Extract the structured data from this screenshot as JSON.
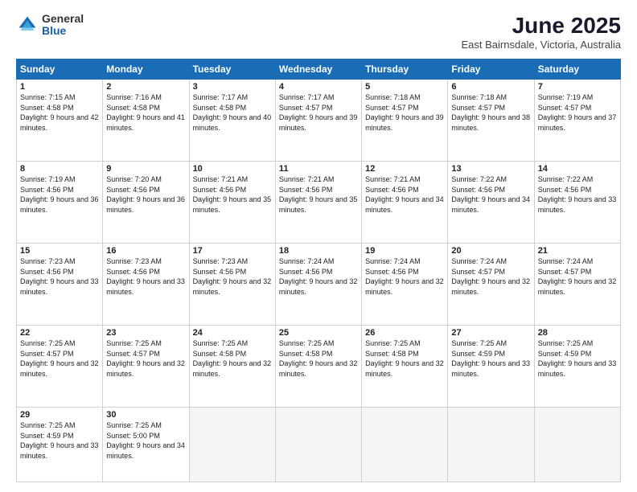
{
  "header": {
    "logo_general": "General",
    "logo_blue": "Blue",
    "title": "June 2025",
    "location": "East Bairnsdale, Victoria, Australia"
  },
  "days_of_week": [
    "Sunday",
    "Monday",
    "Tuesday",
    "Wednesday",
    "Thursday",
    "Friday",
    "Saturday"
  ],
  "weeks": [
    [
      {
        "num": "1",
        "rise": "7:15 AM",
        "set": "4:58 PM",
        "daylight": "9 hours and 42 minutes."
      },
      {
        "num": "2",
        "rise": "7:16 AM",
        "set": "4:58 PM",
        "daylight": "9 hours and 41 minutes."
      },
      {
        "num": "3",
        "rise": "7:17 AM",
        "set": "4:58 PM",
        "daylight": "9 hours and 40 minutes."
      },
      {
        "num": "4",
        "rise": "7:17 AM",
        "set": "4:57 PM",
        "daylight": "9 hours and 39 minutes."
      },
      {
        "num": "5",
        "rise": "7:18 AM",
        "set": "4:57 PM",
        "daylight": "9 hours and 39 minutes."
      },
      {
        "num": "6",
        "rise": "7:18 AM",
        "set": "4:57 PM",
        "daylight": "9 hours and 38 minutes."
      },
      {
        "num": "7",
        "rise": "7:19 AM",
        "set": "4:57 PM",
        "daylight": "9 hours and 37 minutes."
      }
    ],
    [
      {
        "num": "8",
        "rise": "7:19 AM",
        "set": "4:56 PM",
        "daylight": "9 hours and 36 minutes."
      },
      {
        "num": "9",
        "rise": "7:20 AM",
        "set": "4:56 PM",
        "daylight": "9 hours and 36 minutes."
      },
      {
        "num": "10",
        "rise": "7:21 AM",
        "set": "4:56 PM",
        "daylight": "9 hours and 35 minutes."
      },
      {
        "num": "11",
        "rise": "7:21 AM",
        "set": "4:56 PM",
        "daylight": "9 hours and 35 minutes."
      },
      {
        "num": "12",
        "rise": "7:21 AM",
        "set": "4:56 PM",
        "daylight": "9 hours and 34 minutes."
      },
      {
        "num": "13",
        "rise": "7:22 AM",
        "set": "4:56 PM",
        "daylight": "9 hours and 34 minutes."
      },
      {
        "num": "14",
        "rise": "7:22 AM",
        "set": "4:56 PM",
        "daylight": "9 hours and 33 minutes."
      }
    ],
    [
      {
        "num": "15",
        "rise": "7:23 AM",
        "set": "4:56 PM",
        "daylight": "9 hours and 33 minutes."
      },
      {
        "num": "16",
        "rise": "7:23 AM",
        "set": "4:56 PM",
        "daylight": "9 hours and 33 minutes."
      },
      {
        "num": "17",
        "rise": "7:23 AM",
        "set": "4:56 PM",
        "daylight": "9 hours and 32 minutes."
      },
      {
        "num": "18",
        "rise": "7:24 AM",
        "set": "4:56 PM",
        "daylight": "9 hours and 32 minutes."
      },
      {
        "num": "19",
        "rise": "7:24 AM",
        "set": "4:56 PM",
        "daylight": "9 hours and 32 minutes."
      },
      {
        "num": "20",
        "rise": "7:24 AM",
        "set": "4:57 PM",
        "daylight": "9 hours and 32 minutes."
      },
      {
        "num": "21",
        "rise": "7:24 AM",
        "set": "4:57 PM",
        "daylight": "9 hours and 32 minutes."
      }
    ],
    [
      {
        "num": "22",
        "rise": "7:25 AM",
        "set": "4:57 PM",
        "daylight": "9 hours and 32 minutes."
      },
      {
        "num": "23",
        "rise": "7:25 AM",
        "set": "4:57 PM",
        "daylight": "9 hours and 32 minutes."
      },
      {
        "num": "24",
        "rise": "7:25 AM",
        "set": "4:58 PM",
        "daylight": "9 hours and 32 minutes."
      },
      {
        "num": "25",
        "rise": "7:25 AM",
        "set": "4:58 PM",
        "daylight": "9 hours and 32 minutes."
      },
      {
        "num": "26",
        "rise": "7:25 AM",
        "set": "4:58 PM",
        "daylight": "9 hours and 32 minutes."
      },
      {
        "num": "27",
        "rise": "7:25 AM",
        "set": "4:59 PM",
        "daylight": "9 hours and 33 minutes."
      },
      {
        "num": "28",
        "rise": "7:25 AM",
        "set": "4:59 PM",
        "daylight": "9 hours and 33 minutes."
      }
    ],
    [
      {
        "num": "29",
        "rise": "7:25 AM",
        "set": "4:59 PM",
        "daylight": "9 hours and 33 minutes."
      },
      {
        "num": "30",
        "rise": "7:25 AM",
        "set": "5:00 PM",
        "daylight": "9 hours and 34 minutes."
      },
      null,
      null,
      null,
      null,
      null
    ]
  ]
}
